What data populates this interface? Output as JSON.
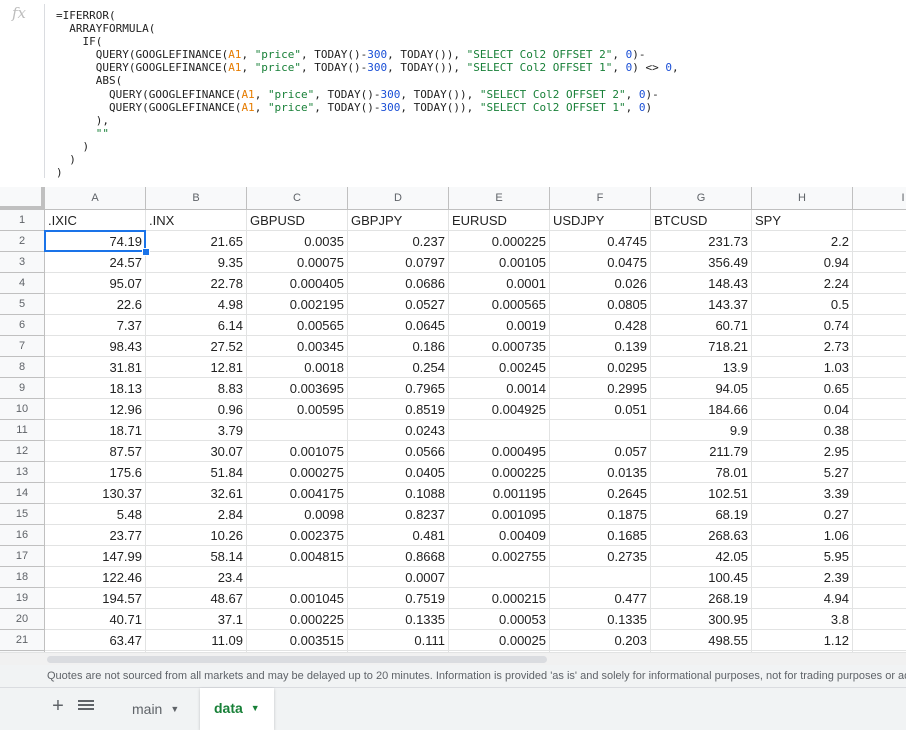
{
  "formula_bar": {
    "fx_icon": "fx",
    "lines": [
      [
        {
          "t": "=IFERROR("
        }
      ],
      [
        {
          "t": "  ARRAYFORMULA("
        }
      ],
      [
        {
          "t": "    IF("
        }
      ],
      [
        {
          "t": "      QUERY(GOOGLEFINANCE("
        },
        {
          "t": "A1",
          "k": "ref"
        },
        {
          "t": ", "
        },
        {
          "t": "\"price\"",
          "k": "str"
        },
        {
          "t": ", TODAY()-"
        },
        {
          "t": "300",
          "k": "num"
        },
        {
          "t": ", TODAY()), "
        },
        {
          "t": "\"SELECT Col2 OFFSET 2\"",
          "k": "str"
        },
        {
          "t": ", "
        },
        {
          "t": "0",
          "k": "num"
        },
        {
          "t": ")-"
        }
      ],
      [
        {
          "t": "      QUERY(GOOGLEFINANCE("
        },
        {
          "t": "A1",
          "k": "ref"
        },
        {
          "t": ", "
        },
        {
          "t": "\"price\"",
          "k": "str"
        },
        {
          "t": ", TODAY()-"
        },
        {
          "t": "300",
          "k": "num"
        },
        {
          "t": ", TODAY()), "
        },
        {
          "t": "\"SELECT Col2 OFFSET 1\"",
          "k": "str"
        },
        {
          "t": ", "
        },
        {
          "t": "0",
          "k": "num"
        },
        {
          "t": ") <> "
        },
        {
          "t": "0",
          "k": "num"
        },
        {
          "t": ","
        }
      ],
      [
        {
          "t": "      ABS("
        }
      ],
      [
        {
          "t": "        QUERY(GOOGLEFINANCE("
        },
        {
          "t": "A1",
          "k": "ref"
        },
        {
          "t": ", "
        },
        {
          "t": "\"price\"",
          "k": "str"
        },
        {
          "t": ", TODAY()-"
        },
        {
          "t": "300",
          "k": "num"
        },
        {
          "t": ", TODAY()), "
        },
        {
          "t": "\"SELECT Col2 OFFSET 2\"",
          "k": "str"
        },
        {
          "t": ", "
        },
        {
          "t": "0",
          "k": "num"
        },
        {
          "t": ")-"
        }
      ],
      [
        {
          "t": "        QUERY(GOOGLEFINANCE("
        },
        {
          "t": "A1",
          "k": "ref"
        },
        {
          "t": ", "
        },
        {
          "t": "\"price\"",
          "k": "str"
        },
        {
          "t": ", TODAY()-"
        },
        {
          "t": "300",
          "k": "num"
        },
        {
          "t": ", TODAY()), "
        },
        {
          "t": "\"SELECT Col2 OFFSET 1\"",
          "k": "str"
        },
        {
          "t": ", "
        },
        {
          "t": "0",
          "k": "num"
        },
        {
          "t": ")"
        }
      ],
      [
        {
          "t": "      ),"
        }
      ],
      [
        {
          "t": "      "
        },
        {
          "t": "\"\"",
          "k": "str"
        }
      ],
      [
        {
          "t": "    )"
        }
      ],
      [
        {
          "t": "  )"
        }
      ],
      [
        {
          "t": ")"
        }
      ]
    ]
  },
  "sheet": {
    "column_headers": [
      "A",
      "B",
      "C",
      "D",
      "E",
      "F",
      "G",
      "H",
      "I"
    ],
    "row_headers": [
      "1",
      "2",
      "3",
      "4",
      "5",
      "6",
      "7",
      "8",
      "9",
      "10",
      "11",
      "12",
      "13",
      "14",
      "15",
      "16",
      "17",
      "18",
      "19",
      "20",
      "21",
      ""
    ],
    "header_row": [
      ".IXIC",
      ".INX",
      "GBPUSD",
      "GBPJPY",
      "EURUSD",
      "USDJPY",
      "BTCUSD",
      "SPY",
      ""
    ],
    "data_rows": [
      [
        "74.19",
        "21.65",
        "0.0035",
        "0.237",
        "0.000225",
        "0.4745",
        "231.73",
        "2.2",
        ""
      ],
      [
        "24.57",
        "9.35",
        "0.00075",
        "0.0797",
        "0.00105",
        "0.0475",
        "356.49",
        "0.94",
        ""
      ],
      [
        "95.07",
        "22.78",
        "0.000405",
        "0.0686",
        "0.0001",
        "0.026",
        "148.43",
        "2.24",
        ""
      ],
      [
        "22.6",
        "4.98",
        "0.002195",
        "0.0527",
        "0.000565",
        "0.0805",
        "143.37",
        "0.5",
        ""
      ],
      [
        "7.37",
        "6.14",
        "0.00565",
        "0.0645",
        "0.0019",
        "0.428",
        "60.71",
        "0.74",
        ""
      ],
      [
        "98.43",
        "27.52",
        "0.00345",
        "0.186",
        "0.000735",
        "0.139",
        "718.21",
        "2.73",
        ""
      ],
      [
        "31.81",
        "12.81",
        "0.0018",
        "0.254",
        "0.00245",
        "0.0295",
        "13.9",
        "1.03",
        ""
      ],
      [
        "18.13",
        "8.83",
        "0.003695",
        "0.7965",
        "0.0014",
        "0.2995",
        "94.05",
        "0.65",
        ""
      ],
      [
        "12.96",
        "0.96",
        "0.00595",
        "0.8519",
        "0.004925",
        "0.051",
        "184.66",
        "0.04",
        ""
      ],
      [
        "18.71",
        "3.79",
        "",
        "0.0243",
        "",
        "",
        "9.9",
        "0.38",
        ""
      ],
      [
        "87.57",
        "30.07",
        "0.001075",
        "0.0566",
        "0.000495",
        "0.057",
        "211.79",
        "2.95",
        ""
      ],
      [
        "175.6",
        "51.84",
        "0.000275",
        "0.0405",
        "0.000225",
        "0.0135",
        "78.01",
        "5.27",
        ""
      ],
      [
        "130.37",
        "32.61",
        "0.004175",
        "0.1088",
        "0.001195",
        "0.2645",
        "102.51",
        "3.39",
        ""
      ],
      [
        "5.48",
        "2.84",
        "0.0098",
        "0.8237",
        "0.001095",
        "0.1875",
        "68.19",
        "0.27",
        ""
      ],
      [
        "23.77",
        "10.26",
        "0.002375",
        "0.481",
        "0.00409",
        "0.1685",
        "268.63",
        "1.06",
        ""
      ],
      [
        "147.99",
        "58.14",
        "0.004815",
        "0.8668",
        "0.002755",
        "0.2735",
        "42.05",
        "5.95",
        ""
      ],
      [
        "122.46",
        "23.4",
        "",
        "0.0007",
        "",
        "",
        "100.45",
        "2.39",
        ""
      ],
      [
        "194.57",
        "48.67",
        "0.001045",
        "0.7519",
        "0.000215",
        "0.477",
        "268.19",
        "4.94",
        ""
      ],
      [
        "40.71",
        "37.1",
        "0.000225",
        "0.1335",
        "0.00053",
        "0.1335",
        "300.95",
        "3.8",
        ""
      ],
      [
        "63.47",
        "11.09",
        "0.003515",
        "0.111",
        "0.00025",
        "0.203",
        "498.55",
        "1.12",
        ""
      ],
      [
        "",
        "",
        "",
        "",
        "",
        "",
        "",
        "",
        ""
      ]
    ],
    "selected_cell": "A2"
  },
  "notice": "Quotes are not sourced from all markets and may be delayed up to 20 minutes. Information is provided 'as is' and solely for informational purposes, not for trading purposes or ad",
  "tabs": {
    "add_icon": "plus-icon",
    "list_icon": "list-icon",
    "items": [
      {
        "label": "main",
        "active": false
      },
      {
        "label": "data",
        "active": true
      }
    ],
    "caret": "▼"
  },
  "colors": {
    "accent": "#1a73e8",
    "active_tab": "#188038",
    "formula_ref": "#e67c00",
    "formula_string": "#188038",
    "formula_number": "#1a4fd6"
  }
}
